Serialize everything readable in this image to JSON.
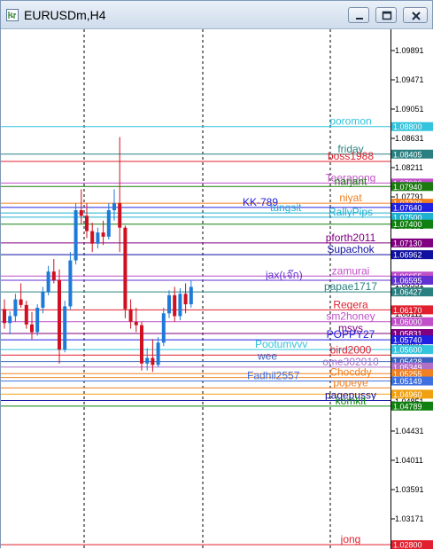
{
  "window": {
    "title": "EURUSDm,H4"
  },
  "axis": {
    "ticks": [
      "1.09891",
      "1.09471",
      "1.09051",
      "1.08631",
      "1.08211",
      "1.07791",
      "1.07371",
      "1.06951",
      "1.06531",
      "1.06111",
      "1.05691",
      "1.05271",
      "1.04851",
      "1.04431",
      "1.04011",
      "1.03591",
      "1.03171",
      "1.02751"
    ],
    "tick_values": [
      1.09891,
      1.09471,
      1.09051,
      1.08631,
      1.08211,
      1.07791,
      1.07371,
      1.06951,
      1.06531,
      1.06111,
      1.05691,
      1.05271,
      1.04851,
      1.04431,
      1.04011,
      1.03591,
      1.03171,
      1.02751
    ],
    "top_price": "1.09891"
  },
  "levels": [
    {
      "name": "poromon",
      "price": 1.088,
      "tag": "1.08800",
      "color": "#33c3dc"
    },
    {
      "name": "friday",
      "price": 1.08405,
      "tag": "1.08405",
      "color": "#2a8080"
    },
    {
      "name": "boss1988",
      "price": 1.083,
      "tag": "",
      "color": "#e0202e"
    },
    {
      "name": "Teerapong",
      "price": 1.0799,
      "tag": "1.07990",
      "color": "#c050c8"
    },
    {
      "name": "narjant",
      "price": 1.0794,
      "tag": "1.07940",
      "color": "#1a7a10"
    },
    {
      "name": "niyat",
      "price": 1.077,
      "tag": "1.07700",
      "color": "#f08020"
    },
    {
      "name": "KK-789",
      "price": 1.0764,
      "tag": "1.07640",
      "color": "#2020e0"
    },
    {
      "name": "tungsit",
      "price": 1.0756,
      "tag": "",
      "color": "#20b0d0"
    },
    {
      "name": "RallyPips",
      "price": 1.075,
      "tag": "1.07500",
      "color": "#20b0d0"
    },
    {
      "name": "",
      "price": 1.074,
      "tag": "1.07400",
      "color": "#108010"
    },
    {
      "name": "pforth2011",
      "price": 1.0713,
      "tag": "1.07130",
      "color": "#800080"
    },
    {
      "name": "Supachok",
      "price": 1.06962,
      "tag": "1.06962",
      "color": "#1010a0"
    },
    {
      "name": "zamurai",
      "price": 1.06655,
      "tag": "1.06655",
      "color": "#c050c8"
    },
    {
      "name": "jax(เจ๊ก)",
      "price": 1.06595,
      "tag": "1.06595",
      "color": "#6030d0"
    },
    {
      "name": "papae1717",
      "price": 1.06427,
      "tag": "1.06427",
      "color": "#2a8080"
    },
    {
      "name": "Regera",
      "price": 1.0617,
      "tag": "1.06170",
      "color": "#e0202e"
    },
    {
      "name": "sm2honey",
      "price": 1.06,
      "tag": "1.06000",
      "color": "#c050c8"
    },
    {
      "name": "msys",
      "price": 1.05831,
      "tag": "1.05831",
      "color": "#800080"
    },
    {
      "name": "POPPY27",
      "price": 1.0574,
      "tag": "1.05740",
      "color": "#2020e0"
    },
    {
      "name": "Pootumvvv",
      "price": 1.056,
      "tag": "1.05600",
      "color": "#33c3dc"
    },
    {
      "name": "bird2000",
      "price": 1.0552,
      "tag": "",
      "color": "#e0202e"
    },
    {
      "name": "wee",
      "price": 1.05428,
      "tag": "1.05428",
      "color": "#3a60c0"
    },
    {
      "name": "ome302010",
      "price": 1.05349,
      "tag": "1.05349",
      "color": "#b070c8"
    },
    {
      "name": "",
      "price": 1.05255,
      "tag": "1.05255",
      "color": "#f08020"
    },
    {
      "name": "Chocddy",
      "price": 1.052,
      "tag": "",
      "color": "#f08020"
    },
    {
      "name": "Fadhil2557",
      "price": 1.05149,
      "tag": "1.05149",
      "color": "#4070e0"
    },
    {
      "name": "popeye",
      "price": 1.0505,
      "tag": "",
      "color": "#f08020"
    },
    {
      "name": "",
      "price": 1.0496,
      "tag": "1.04960",
      "color": "#f0a010"
    },
    {
      "name": "pagepussy",
      "price": 1.0487,
      "tag": "",
      "color": "#1010a0"
    },
    {
      "name": "komkit",
      "price": 1.04789,
      "tag": "1.04789",
      "color": "#108010"
    },
    {
      "name": "jong",
      "price": 1.028,
      "tag": "1.02800",
      "color": "#e0202e"
    }
  ],
  "candles": [
    {
      "o": 1.0618,
      "h": 1.0632,
      "l": 1.059,
      "c": 1.0598
    },
    {
      "o": 1.0598,
      "h": 1.0615,
      "l": 1.0582,
      "c": 1.0608
    },
    {
      "o": 1.0608,
      "h": 1.064,
      "l": 1.06,
      "c": 1.0632
    },
    {
      "o": 1.0632,
      "h": 1.0655,
      "l": 1.062,
      "c": 1.0624
    },
    {
      "o": 1.0624,
      "h": 1.063,
      "l": 1.059,
      "c": 1.0596
    },
    {
      "o": 1.0596,
      "h": 1.0614,
      "l": 1.0575,
      "c": 1.0585
    },
    {
      "o": 1.0585,
      "h": 1.0625,
      "l": 1.058,
      "c": 1.062
    },
    {
      "o": 1.062,
      "h": 1.065,
      "l": 1.0612,
      "c": 1.0643
    },
    {
      "o": 1.0643,
      "h": 1.068,
      "l": 1.0638,
      "c": 1.0672
    },
    {
      "o": 1.0672,
      "h": 1.069,
      "l": 1.0655,
      "c": 1.066
    },
    {
      "o": 1.066,
      "h": 1.0675,
      "l": 1.054,
      "c": 1.056
    },
    {
      "o": 1.056,
      "h": 1.063,
      "l": 1.0556,
      "c": 1.0622
    },
    {
      "o": 1.0622,
      "h": 1.07,
      "l": 1.0618,
      "c": 1.0688
    },
    {
      "o": 1.0688,
      "h": 1.077,
      "l": 1.0682,
      "c": 1.076
    },
    {
      "o": 1.076,
      "h": 1.079,
      "l": 1.074,
      "c": 1.0752
    },
    {
      "o": 1.0752,
      "h": 1.077,
      "l": 1.072,
      "c": 1.073
    },
    {
      "o": 1.073,
      "h": 1.0742,
      "l": 1.07,
      "c": 1.0712
    },
    {
      "o": 1.0712,
      "h": 1.0735,
      "l": 1.0705,
      "c": 1.0728
    },
    {
      "o": 1.0728,
      "h": 1.0745,
      "l": 1.071,
      "c": 1.0722
    },
    {
      "o": 1.0722,
      "h": 1.077,
      "l": 1.0718,
      "c": 1.076
    },
    {
      "o": 1.076,
      "h": 1.079,
      "l": 1.0745,
      "c": 1.077
    },
    {
      "o": 1.077,
      "h": 1.0865,
      "l": 1.07,
      "c": 1.0735
    },
    {
      "o": 1.0735,
      "h": 1.0738,
      "l": 1.0605,
      "c": 1.0618
    },
    {
      "o": 1.0618,
      "h": 1.0632,
      "l": 1.059,
      "c": 1.06
    },
    {
      "o": 1.06,
      "h": 1.062,
      "l": 1.0585,
      "c": 1.0595
    },
    {
      "o": 1.0595,
      "h": 1.06,
      "l": 1.053,
      "c": 1.054
    },
    {
      "o": 1.054,
      "h": 1.0562,
      "l": 1.053,
      "c": 1.0548
    },
    {
      "o": 1.0548,
      "h": 1.0575,
      "l": 1.0528,
      "c": 1.0538
    },
    {
      "o": 1.0538,
      "h": 1.0578,
      "l": 1.0535,
      "c": 1.057
    },
    {
      "o": 1.057,
      "h": 1.062,
      "l": 1.0565,
      "c": 1.0612
    },
    {
      "o": 1.0612,
      "h": 1.0645,
      "l": 1.0605,
      "c": 1.0638
    },
    {
      "o": 1.0638,
      "h": 1.065,
      "l": 1.06,
      "c": 1.0608
    },
    {
      "o": 1.0608,
      "h": 1.0648,
      "l": 1.0602,
      "c": 1.064
    },
    {
      "o": 1.064,
      "h": 1.0655,
      "l": 1.0612,
      "c": 1.0625
    },
    {
      "o": 1.0625,
      "h": 1.066,
      "l": 1.062,
      "c": 1.065
    }
  ]
}
